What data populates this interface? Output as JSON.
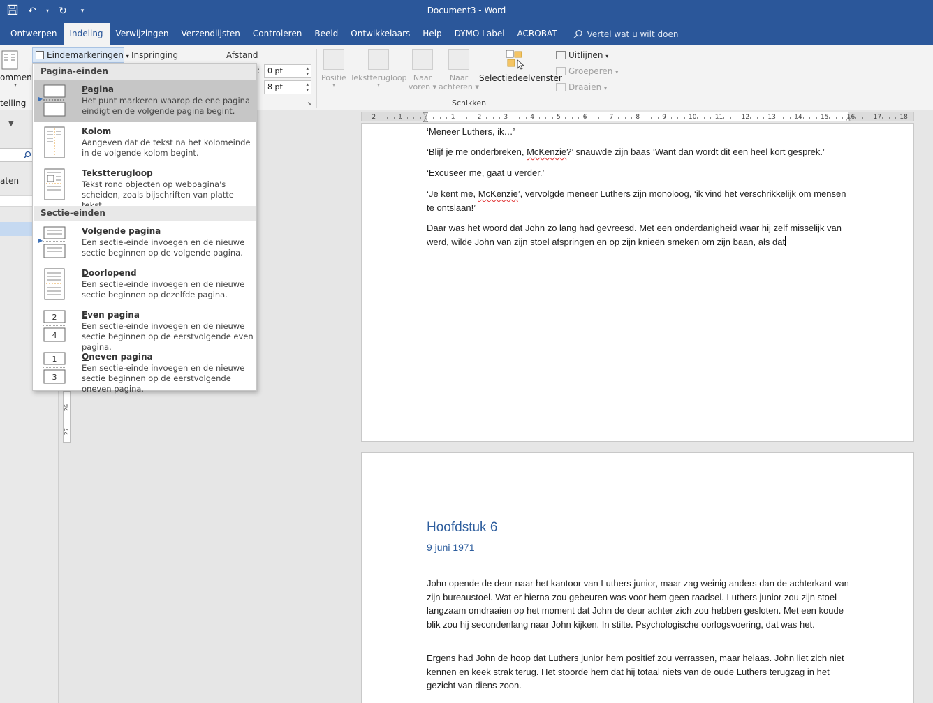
{
  "window": {
    "title": "Document3  -  Word"
  },
  "tabs": [
    {
      "label": "Ontwerpen",
      "active": false
    },
    {
      "label": "Indeling",
      "active": true
    },
    {
      "label": "Verwijzingen",
      "active": false
    },
    {
      "label": "Verzendlijsten",
      "active": false
    },
    {
      "label": "Controleren",
      "active": false
    },
    {
      "label": "Beeld",
      "active": false
    },
    {
      "label": "Ontwikkelaars",
      "active": false
    },
    {
      "label": "Help",
      "active": false
    },
    {
      "label": "DYMO Label",
      "active": false
    },
    {
      "label": "ACROBAT",
      "active": false
    }
  ],
  "tell_me": "Vertel wat u wilt doen",
  "ribbon": {
    "columns_label": "ommen",
    "setup_group_label": "telling",
    "breaks_label": "Eindemarkeringen",
    "indent_label": "Inspringing",
    "spacing_label": "Afstand",
    "spacing_colon": ":",
    "spacing_before": "0 pt",
    "spacing_after": "8 pt",
    "position_label": "Positie",
    "wrap_label": "Tekstterugloop",
    "forward_label_1": "Naar",
    "forward_label_2": "voren",
    "backward_label_1": "Naar",
    "backward_label_2": "achteren",
    "selection_pane_label": "Selectiedeelvenster",
    "align_label": "Uitlijnen",
    "group_label": "Groeperen",
    "rotate_label": "Draaien",
    "arrange_group_label": "Schikken"
  },
  "leftpane": {
    "partial_text": "aten"
  },
  "breaks_menu": {
    "page_breaks_header": "Pagina-einden",
    "section_breaks_header": "Sectie-einden",
    "items": [
      {
        "title_ul": "P",
        "title_rest": "agina",
        "desc": "Het punt markeren waarop de ene pagina eindigt en de volgende pagina begint."
      },
      {
        "title_ul": "K",
        "title_rest": "olom",
        "desc": "Aangeven dat de tekst na het kolomeinde in de volgende kolom begint."
      },
      {
        "title_ul": "T",
        "title_rest": "ekstterugloop",
        "desc": "Tekst rond objecten op webpagina's scheiden, zoals bijschriften van platte tekst."
      },
      {
        "title_ul": "V",
        "title_rest": "olgende pagina",
        "desc": "Een sectie-einde invoegen en de nieuwe sectie beginnen op de volgende pagina."
      },
      {
        "title_ul": "D",
        "title_rest": "oorlopend",
        "desc": "Een sectie-einde invoegen en de nieuwe sectie beginnen op dezelfde pagina."
      },
      {
        "title_ul": "E",
        "title_rest": "ven pagina",
        "desc": "Een sectie-einde invoegen en de nieuwe sectie beginnen op de eerstvolgende even pagina."
      },
      {
        "title_ul": "O",
        "title_rest": "neven pagina",
        "desc": "Een sectie-einde invoegen en de nieuwe sectie beginnen op de eerstvolgende oneven pagina."
      }
    ]
  },
  "hruler_labels": [
    "2",
    "1",
    "1",
    "2",
    "3",
    "4",
    "5",
    "6",
    "7",
    "8",
    "9",
    "10",
    "11",
    "12",
    "13",
    "14",
    "15",
    "16",
    "17",
    "18"
  ],
  "vruler_labels": [
    "26",
    "27"
  ],
  "doc": {
    "page1": {
      "p0": "‘Meneer Luthers, ik…’",
      "p1_a": "‘Blijf je me onderbreken, ",
      "p1_name": "McKenzie",
      "p1_b": "?’ snauwde zijn baas ‘Want dan wordt dit een heel kort gesprek.’",
      "p2": "‘Excuseer me, gaat u verder.’",
      "p3_a": "‘Je kent me, ",
      "p3_name": "McKenzie",
      "p3_b": "’, vervolgde meneer Luthers zijn monoloog, ‘ik vind het verschrikkelijk om mensen te ontslaan!’",
      "p4": "Daar was het woord dat John zo lang had gevreesd. Met een onderdanigheid waar hij zelf misselijk van werd, wilde John van zijn stoel afspringen en op zijn knieën smeken om zijn baan, als dat"
    },
    "page2": {
      "heading": "Hoofdstuk 6",
      "subheading": "9 juni 1971",
      "p1": "John opende de deur naar het kantoor van Luthers junior, maar zag weinig anders dan de achterkant van zijn bureaustoel. Wat er hierna zou gebeuren was voor hem geen raadsel. Luthers junior zou zijn stoel langzaam omdraaien op het moment dat John de deur achter zich zou hebben gesloten. Met een koude blik zou hij secondenlang naar John kijken. In stilte. Psychologische oorlogsvoering, dat was het.",
      "p2": "Ergens had John de hoop dat Luthers junior hem positief zou verrassen, maar helaas. John liet zich niet kennen en keek strak terug. Het stoorde hem dat hij totaal niets van de oude Luthers terugzag in het gezicht van diens zoon."
    }
  }
}
